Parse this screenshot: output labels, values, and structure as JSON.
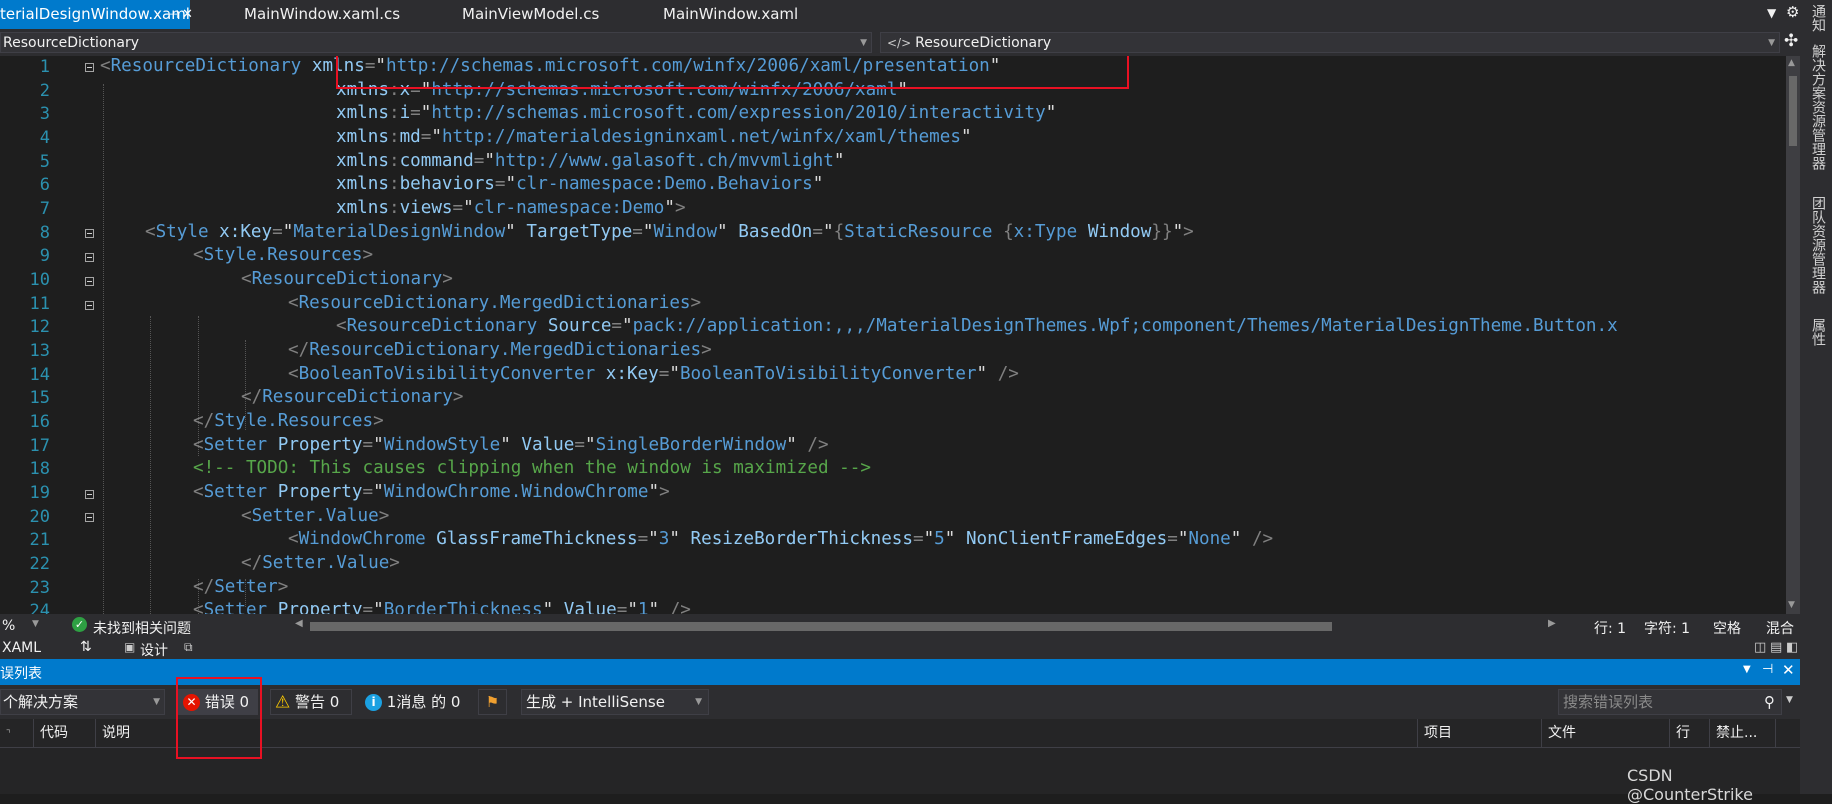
{
  "tabs": [
    {
      "label": "terialDesignWindow.xaml",
      "active": true
    },
    {
      "label": "MainWindow.xaml.cs",
      "active": false
    },
    {
      "label": "MainViewModel.cs",
      "active": false
    },
    {
      "label": "MainWindow.xaml",
      "active": false
    }
  ],
  "navbar": {
    "left": "ResourceDictionary",
    "right": "ResourceDictionary"
  },
  "editor": {
    "line_numbers": [
      "1",
      "2",
      "3",
      "4",
      "5",
      "6",
      "7",
      "8",
      "9",
      "10",
      "11",
      "12",
      "13",
      "14",
      "15",
      "16",
      "17",
      "18",
      "19",
      "20",
      "21",
      "22",
      "23",
      "24"
    ],
    "comment_line": "<!-- TODO: This causes clipping when the window is maximized -->"
  },
  "status": {
    "zoom": "%",
    "issues": "未找到相关问题",
    "row": "行: 1",
    "char": "字符: 1",
    "space": "空格",
    "mixed": "混合"
  },
  "xaml_row": {
    "tab": "XAML",
    "design": "设计"
  },
  "error_list": {
    "title": "误列表",
    "scope": "个解决方案",
    "errors": "错误 0",
    "warnings": "警告 0",
    "messages": "1消息 的 0",
    "build_filter": "生成 + IntelliSense",
    "search_placeholder": "搜索错误列表",
    "columns": {
      "code": "代码",
      "desc": "说明",
      "project": "项目",
      "file": "文件",
      "line": "行",
      "suppress": "禁止..."
    }
  },
  "sidebar": {
    "items": [
      "通知",
      "解决方案资源管理器",
      "团队资源管理器",
      "属性"
    ]
  },
  "watermark": "CSDN @CounterStrike",
  "colors": {
    "accent": "#007acc",
    "highlight_box": "#e81123"
  }
}
